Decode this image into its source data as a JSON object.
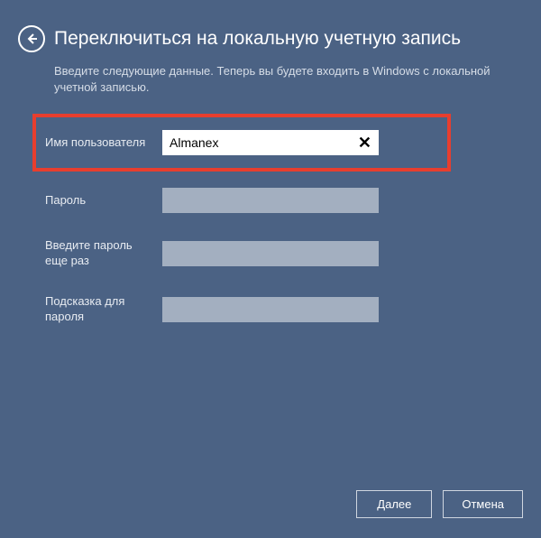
{
  "header": {
    "title": "Переключиться на локальную учетную запись",
    "subtitle": "Введите следующие данные. Теперь вы будете входить в Windows с локальной учетной записью."
  },
  "form": {
    "username": {
      "label": "Имя пользователя",
      "value": "Almanex"
    },
    "password": {
      "label": "Пароль",
      "value": ""
    },
    "password_confirm": {
      "label": "Введите пароль еще раз",
      "value": ""
    },
    "hint": {
      "label": "Подсказка для пароля",
      "value": ""
    }
  },
  "footer": {
    "next": "Далее",
    "cancel": "Отмена"
  },
  "icons": {
    "clear": "✕"
  }
}
